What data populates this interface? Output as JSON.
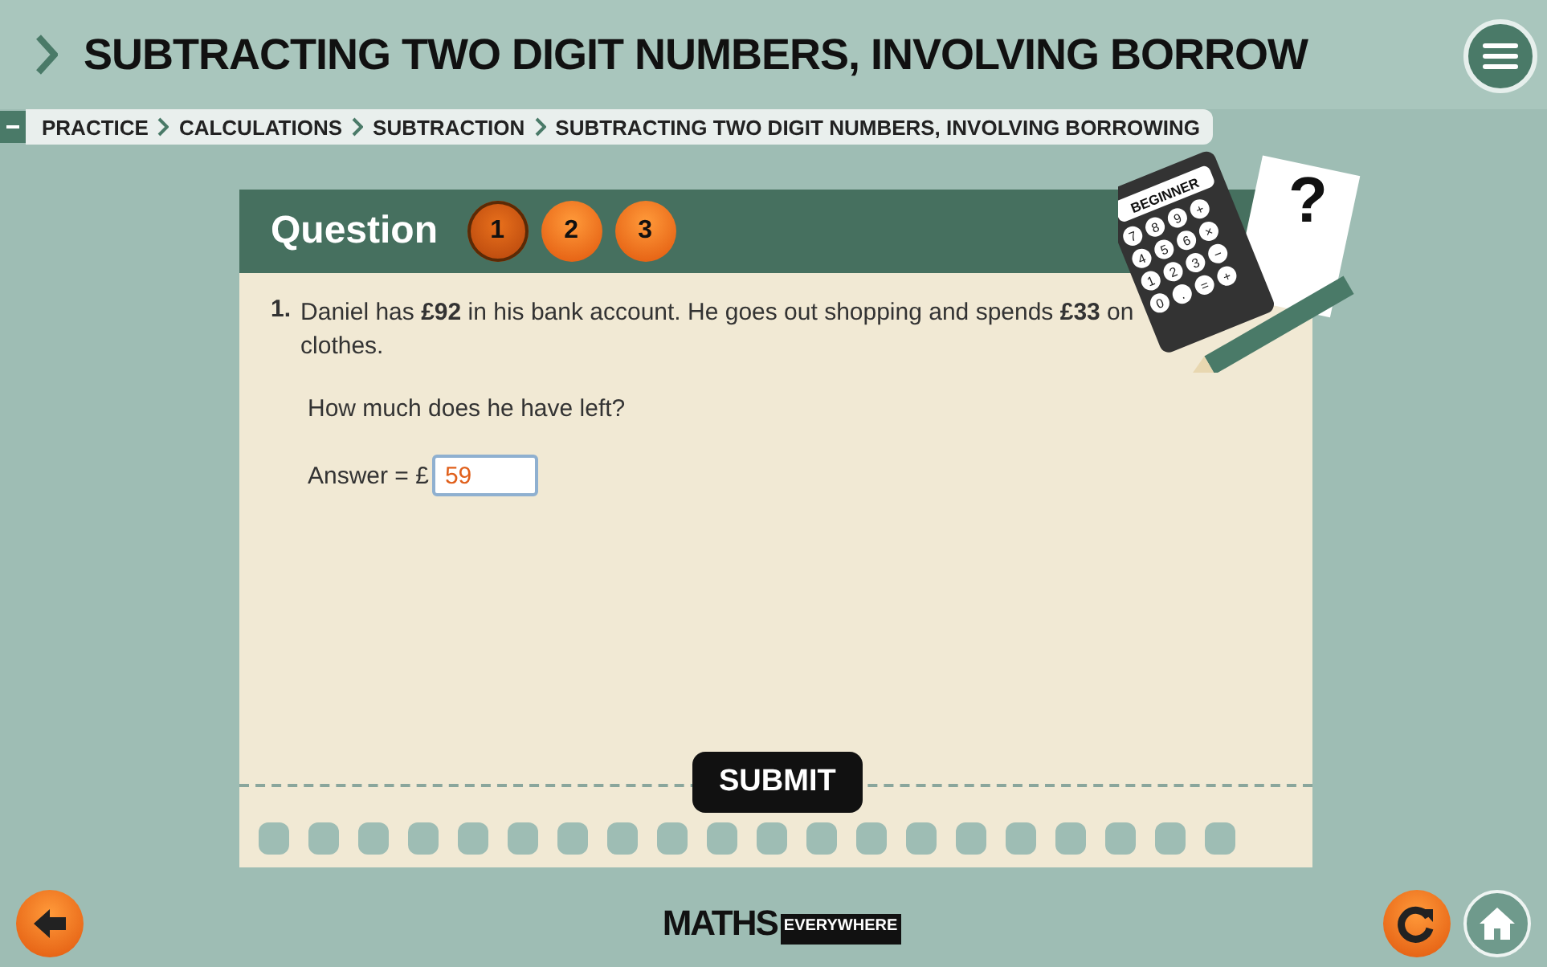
{
  "header": {
    "title": "SUBTRACTING TWO DIGIT NUMBERS, INVOLVING BORROW"
  },
  "breadcrumb": [
    {
      "label": "PRACTICE"
    },
    {
      "label": "CALCULATIONS"
    },
    {
      "label": "SUBTRACTION"
    },
    {
      "label": "SUBTRACTING TWO DIGIT NUMBERS, INVOLVING BORROWING"
    }
  ],
  "question_card": {
    "heading": "Question",
    "steps": [
      {
        "label": "1",
        "selected": true
      },
      {
        "label": "2",
        "selected": false
      },
      {
        "label": "3",
        "selected": false
      }
    ],
    "number": "1.",
    "text": "Daniel has **£92** in his bank account. He goes out shopping and spends **£33** on clothes.",
    "prompt": "How much does he have left?",
    "answer_label": "Answer = £",
    "answer_value": "59",
    "submit": "SUBMIT"
  },
  "calculator": {
    "level": "BEGINNER",
    "keys": [
      "7",
      "8",
      "9",
      "+",
      "4",
      "5",
      "6",
      "×",
      "1",
      "2",
      "3",
      "−",
      "0",
      ".",
      "=",
      "+"
    ],
    "mark": "?"
  },
  "footer": {
    "logo_main": "MATHS",
    "logo_sub": "EVERYWHERE"
  }
}
